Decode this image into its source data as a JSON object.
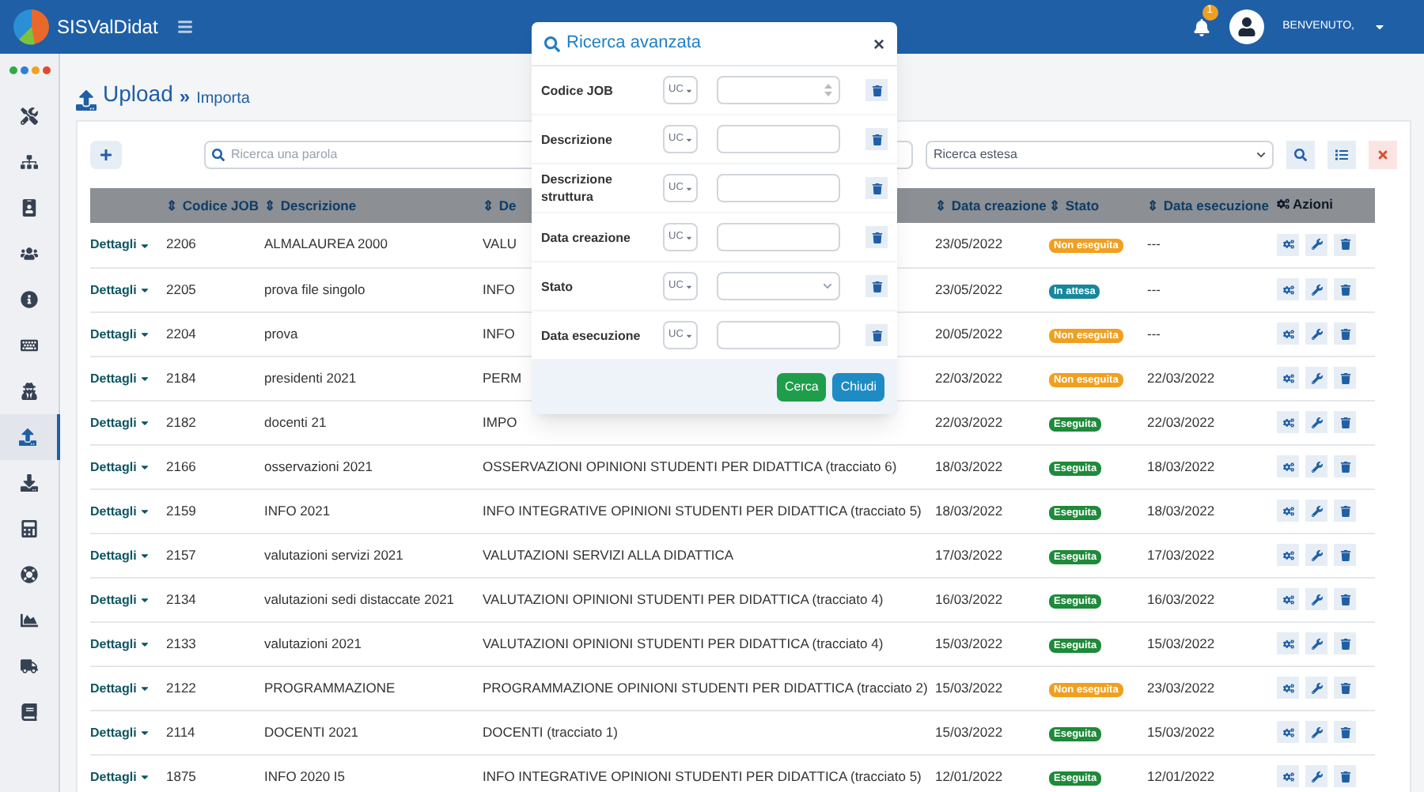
{
  "app": {
    "name": "SISValDidat"
  },
  "user": {
    "greeting": "BENVENUTO,",
    "notifications": "1"
  },
  "breadcrumb": {
    "section": "Upload",
    "separator": "»",
    "page": "Importa"
  },
  "toolbar": {
    "search_placeholder": "Ricerca una parola",
    "extended_search": "Ricerca estesa"
  },
  "table": {
    "columns": [
      "⇕ Codice JOB",
      "⇕ Descrizione",
      "⇕ De",
      "⇕ Data creazione",
      "⇕ Stato",
      "⇕ Data esecuzione",
      "Azioni"
    ],
    "rows": [
      {
        "details": "Dettagli",
        "code": "2206",
        "description": "ALMALAUREA 2000",
        "structure": "VALU",
        "created": "23/05/2022",
        "status": {
          "label": "Non eseguita",
          "color": "#f0a020"
        },
        "executed": "---"
      },
      {
        "details": "Dettagli",
        "code": "2205",
        "description": "prova file singolo",
        "structure": "INFO",
        "created": "23/05/2022",
        "status": {
          "label": "In attesa",
          "color": "#17879e"
        },
        "executed": "---"
      },
      {
        "details": "Dettagli",
        "code": "2204",
        "description": "prova",
        "structure": "INFO",
        "created": "20/05/2022",
        "status": {
          "label": "Non eseguita",
          "color": "#f0a020"
        },
        "executed": "---"
      },
      {
        "details": "Dettagli",
        "code": "2184",
        "description": "presidenti 2021",
        "structure": "PERM",
        "created": "22/03/2022",
        "status": {
          "label": "Non eseguita",
          "color": "#f0a020"
        },
        "executed": "22/03/2022"
      },
      {
        "details": "Dettagli",
        "code": "2182",
        "description": "docenti 21",
        "structure": "IMPO",
        "created": "22/03/2022",
        "status": {
          "label": "Eseguita",
          "color": "#1e8a3a"
        },
        "executed": "22/03/2022"
      },
      {
        "details": "Dettagli",
        "code": "2166",
        "description": "osservazioni 2021",
        "structure": "OSSERVAZIONI OPINIONI STUDENTI PER DIDATTICA (tracciato 6)",
        "created": "18/03/2022",
        "status": {
          "label": "Eseguita",
          "color": "#1e8a3a"
        },
        "executed": "18/03/2022"
      },
      {
        "details": "Dettagli",
        "code": "2159",
        "description": "INFO 2021",
        "structure": "INFO INTEGRATIVE OPINIONI STUDENTI PER DIDATTICA (tracciato 5)",
        "created": "18/03/2022",
        "status": {
          "label": "Eseguita",
          "color": "#1e8a3a"
        },
        "executed": "18/03/2022"
      },
      {
        "details": "Dettagli",
        "code": "2157",
        "description": "valutazioni servizi 2021",
        "structure": "VALUTAZIONI SERVIZI ALLA DIDATTICA",
        "created": "17/03/2022",
        "status": {
          "label": "Eseguita",
          "color": "#1e8a3a"
        },
        "executed": "17/03/2022"
      },
      {
        "details": "Dettagli",
        "code": "2134",
        "description": "valutazioni sedi distaccate 2021",
        "structure": "VALUTAZIONI OPINIONI STUDENTI PER DIDATTICA (tracciato 4)",
        "created": "16/03/2022",
        "status": {
          "label": "Eseguita",
          "color": "#1e8a3a"
        },
        "executed": "16/03/2022"
      },
      {
        "details": "Dettagli",
        "code": "2133",
        "description": "valutazioni 2021",
        "structure": "VALUTAZIONI OPINIONI STUDENTI PER DIDATTICA (tracciato 4)",
        "created": "15/03/2022",
        "status": {
          "label": "Eseguita",
          "color": "#1e8a3a"
        },
        "executed": "15/03/2022"
      },
      {
        "details": "Dettagli",
        "code": "2122",
        "description": "PROGRAMMAZIONE",
        "structure": "PROGRAMMAZIONE OPINIONI STUDENTI PER DIDATTICA (tracciato 2)",
        "created": "15/03/2022",
        "status": {
          "label": "Non eseguita",
          "color": "#f0a020"
        },
        "executed": "23/03/2022"
      },
      {
        "details": "Dettagli",
        "code": "2114",
        "description": "DOCENTI 2021",
        "structure": "DOCENTI (tracciato 1)",
        "created": "15/03/2022",
        "status": {
          "label": "Eseguita",
          "color": "#1e8a3a"
        },
        "executed": "15/03/2022"
      },
      {
        "details": "Dettagli",
        "code": "1875",
        "description": "INFO 2020 I5",
        "structure": "INFO INTEGRATIVE OPINIONI STUDENTI PER DIDATTICA (tracciato 5)",
        "created": "12/01/2022",
        "status": {
          "label": "Eseguita",
          "color": "#1e8a3a"
        },
        "executed": "12/01/2022"
      }
    ]
  },
  "sidebar": {
    "items": [
      {
        "selected": false
      },
      {
        "selected": false
      },
      {
        "selected": false
      },
      {
        "selected": false
      },
      {
        "selected": false
      },
      {
        "selected": false
      },
      {
        "selected": false
      },
      {
        "selected": true
      },
      {
        "selected": false
      },
      {
        "selected": false
      },
      {
        "selected": false
      },
      {
        "selected": false
      },
      {
        "selected": false
      },
      {
        "selected": false
      }
    ]
  },
  "modal": {
    "title": "Ricerca avanzata",
    "close": "×",
    "fields": [
      {
        "label": "Codice JOB",
        "operator": "UC",
        "kind": "number"
      },
      {
        "label": "Descrizione",
        "operator": "UC",
        "kind": "text"
      },
      {
        "label": "Descrizione struttura",
        "operator": "UC",
        "kind": "text"
      },
      {
        "label": "Data creazione",
        "operator": "UC",
        "kind": "text"
      },
      {
        "label": "Stato",
        "operator": "UC",
        "kind": "select"
      },
      {
        "label": "Data esecuzione",
        "operator": "UC",
        "kind": "text"
      }
    ],
    "buttons": [
      {
        "label": "Cerca",
        "kind": "primary"
      },
      {
        "label": "Chiudi",
        "kind": "secondary"
      }
    ]
  }
}
